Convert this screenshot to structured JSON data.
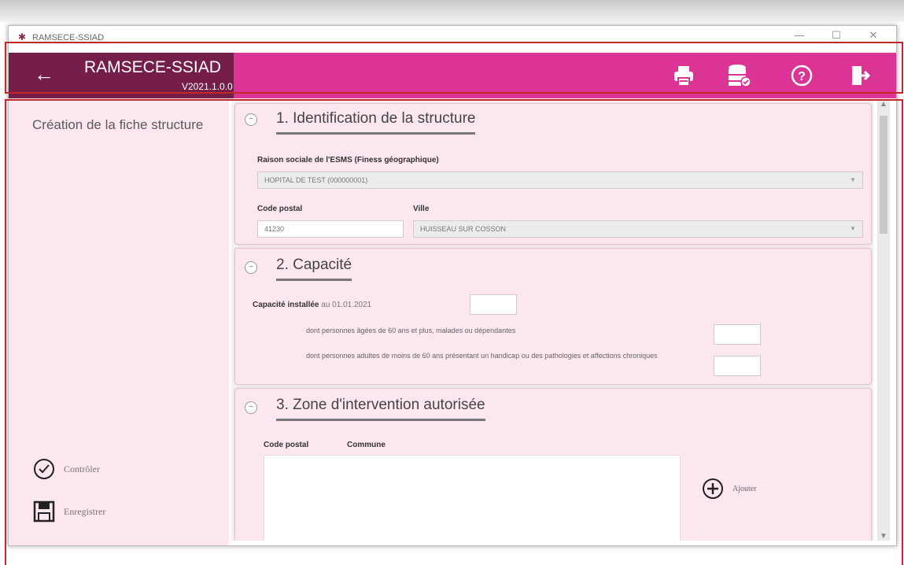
{
  "window": {
    "title": "RAMSECE-SSIAD",
    "controls": [
      "—",
      "☐",
      "✕"
    ]
  },
  "header": {
    "back_icon": "arrow-left-icon",
    "title": "RAMSECE-SSIAD",
    "version": "V2021.1.0.0",
    "icons": [
      "printer-icon",
      "database-check-icon",
      "help-icon",
      "exit-icon"
    ],
    "colors": {
      "brand": "#751e4a",
      "bar": "#db3494"
    }
  },
  "left_panel": {
    "title": "Création de la fiche structure",
    "actions": [
      {
        "icon": "check-circle-icon",
        "label": "Contrôler"
      },
      {
        "icon": "save-icon",
        "label": "Enregistrer"
      }
    ],
    "background": "#fce7f0"
  },
  "sections": {
    "identification": {
      "title": "1. Identification de la structure",
      "raison_label": "Raison sociale de l'ESMS (Finess géographique)",
      "raison_value": "HOPITAL DE TEST (000000001)",
      "cp_label": "Code postal",
      "cp_value": "41230",
      "ville_label": "Ville",
      "ville_value": "HUISSEAU SUR COSSON"
    },
    "capacite": {
      "title": "2. Capacité",
      "inst_label": "Capacité installée",
      "inst_date": "au 01.01.2021",
      "line1": "dont personnes âgées de 60 ans et plus, malades ou dépendantes",
      "line2": "dont personnes adultes de moins de 60 ans présentant un handicap ou des pathologies et affections chroniques"
    },
    "zone": {
      "title": "3. Zone d'intervention autorisée",
      "col1": "Code postal",
      "col2": "Commune",
      "add_label": "Ajouter"
    }
  }
}
